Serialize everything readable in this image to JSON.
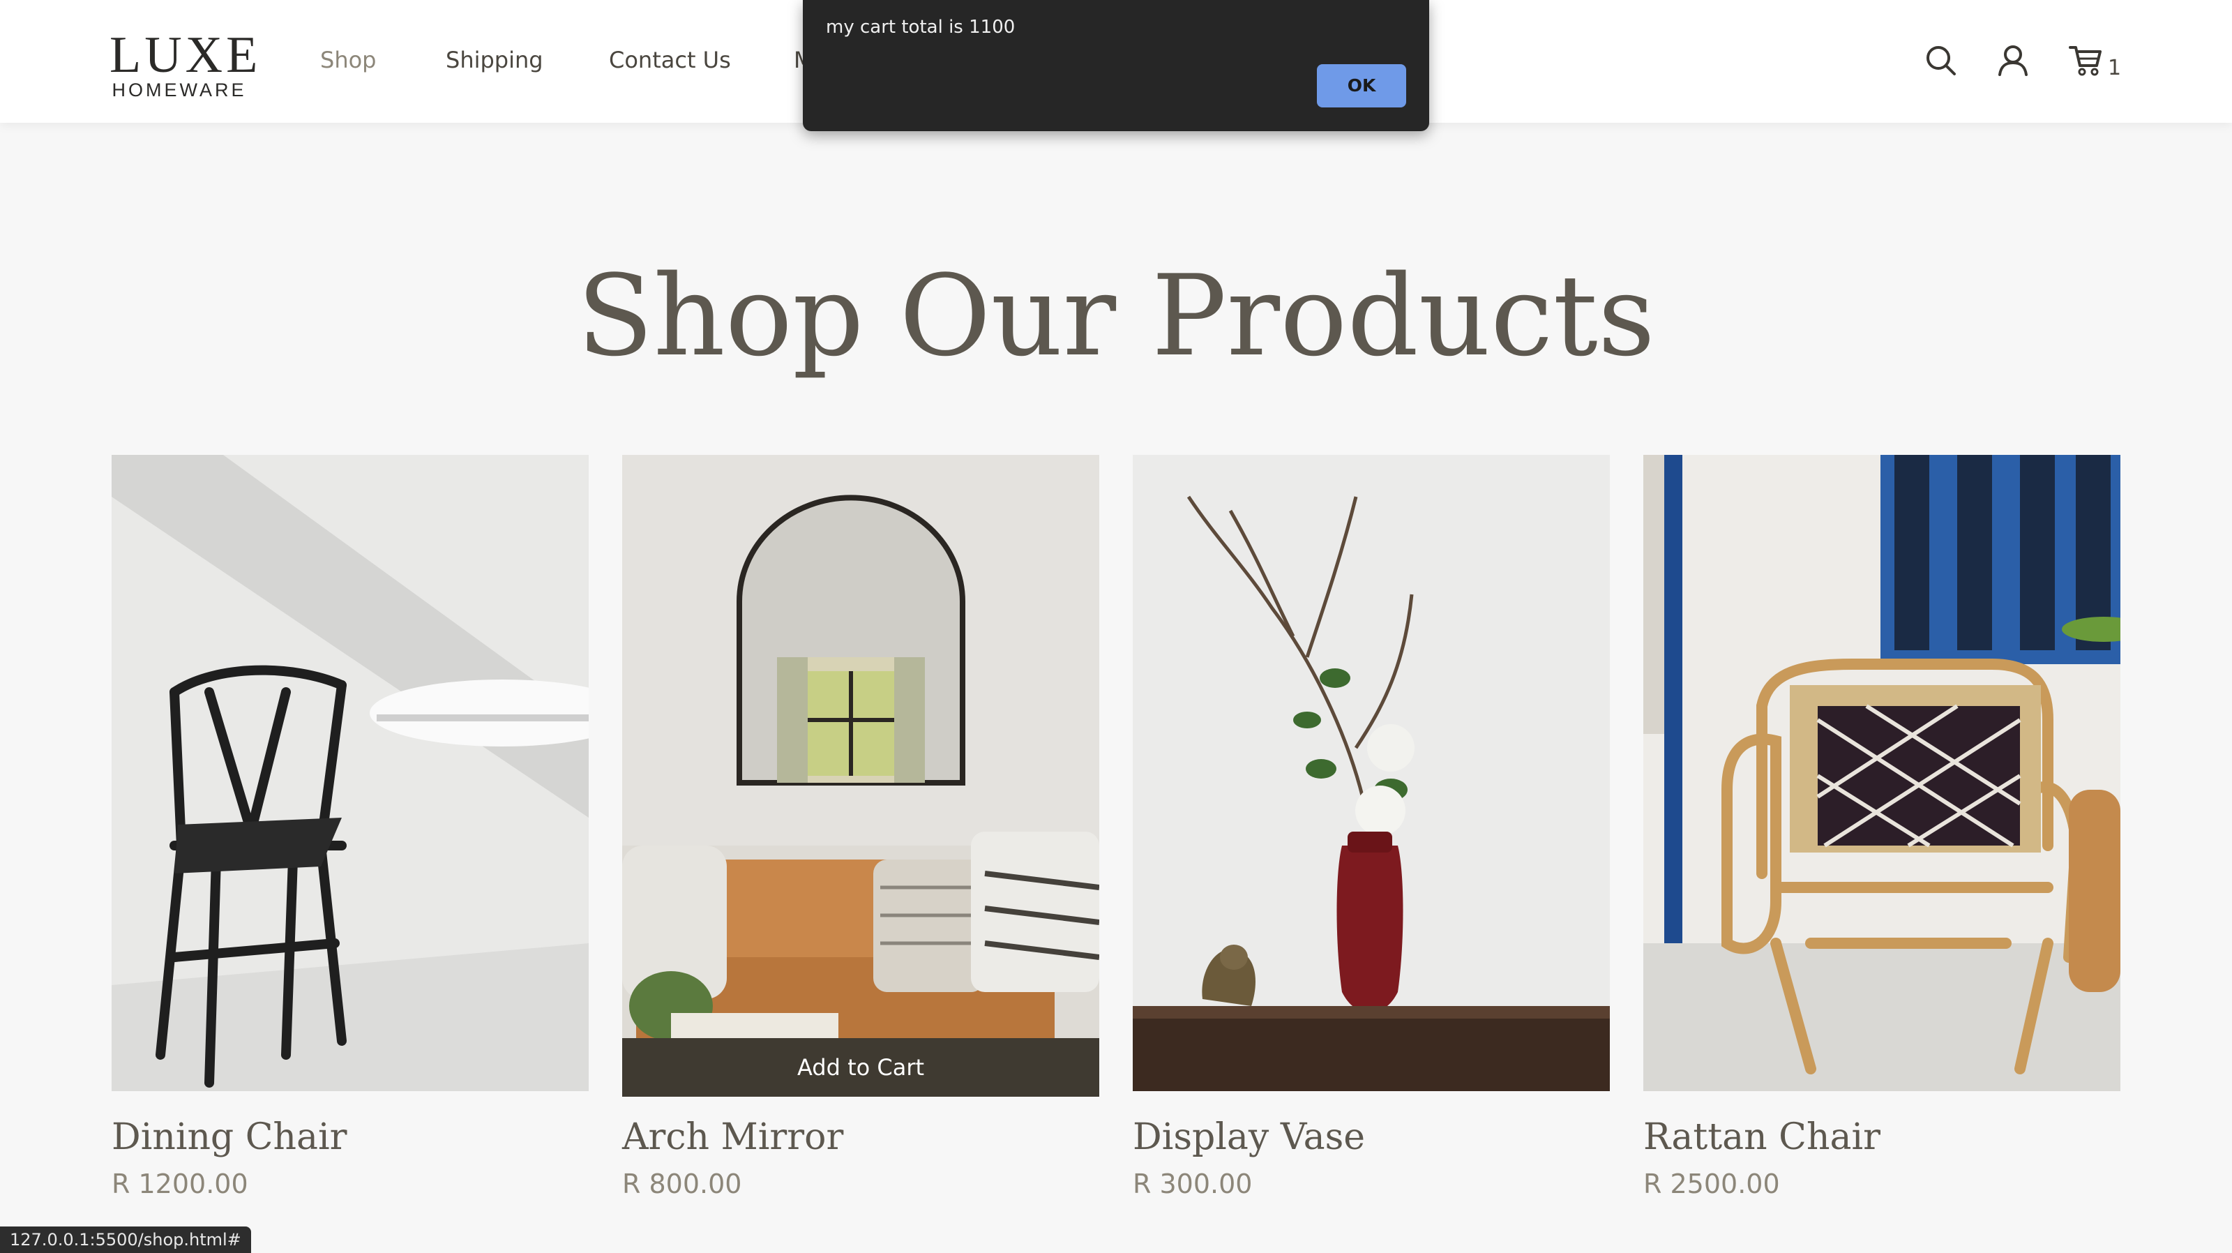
{
  "header": {
    "logo_main": "LUXE",
    "logo_sub": "HOMEWARE",
    "nav": [
      "Shop",
      "Shipping",
      "Contact Us",
      "M"
    ],
    "cart_count": "1"
  },
  "alert": {
    "message": "my cart total is 1100",
    "ok_label": "OK"
  },
  "page_title": "Shop Our Products",
  "products": [
    {
      "name": "Dining Chair",
      "price": "R 1200.00"
    },
    {
      "name": "Arch Mirror",
      "price": "R 800.00",
      "hover_button": "Add to Cart"
    },
    {
      "name": "Display Vase",
      "price": "R 300.00"
    },
    {
      "name": "Rattan Chair",
      "price": "R 2500.00"
    }
  ],
  "status_url": "127.0.0.1:5500/shop.html#",
  "icons": [
    "search-icon",
    "account-icon",
    "cart-icon"
  ]
}
